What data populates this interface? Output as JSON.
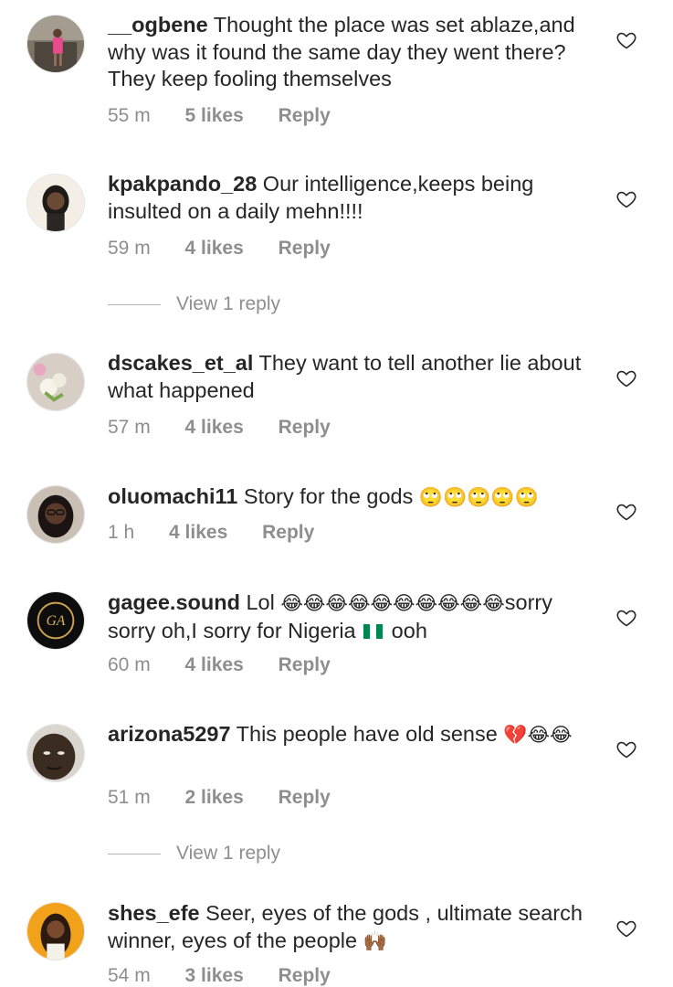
{
  "comments": [
    {
      "user": "__ogbene",
      "text": " Thought the place was set ablaze,and why was it found the same day they went there? They keep fooling themselves",
      "time": "55 m",
      "likes": "5 likes",
      "reply": "Reply",
      "avatar_color": "#7a6a5a"
    },
    {
      "user": "kpakpando_28",
      "text": " Our intelligence,keeps being insulted on a daily mehn!!!!",
      "time": "59 m",
      "likes": "4 likes",
      "reply": "Reply",
      "avatar_color": "#e8dcc8",
      "view_replies": "View 1 reply"
    },
    {
      "user": "dscakes_et_al",
      "text": " They want to tell another lie about what happened",
      "time": "57 m",
      "likes": "4 likes",
      "reply": "Reply",
      "avatar_color": "#d8cfc7"
    },
    {
      "user": "oluomachi11",
      "text": " Story for the gods ",
      "emoji": "🙄🙄🙄🙄🙄",
      "time": "1 h",
      "likes": "4 likes",
      "reply": "Reply",
      "avatar_color": "#3a2a22"
    },
    {
      "user": "gagee.sound",
      "text": " Lol ",
      "emoji": "😂😂😂😂😂😂😂😂😂😂",
      "text2": "sorry sorry oh,I sorry for Nigeria ",
      "flag": "🇳🇬",
      "text3": " ooh",
      "time": "60 m",
      "likes": "4 likes",
      "reply": "Reply",
      "avatar_color": "#111111",
      "avatar_logo": "GA"
    },
    {
      "user": "arizona5297",
      "text": " This people have old sense ",
      "emoji": "💔😂😂",
      "time": "51 m",
      "likes": "2 likes",
      "reply": "Reply",
      "avatar_color": "#4a3b30",
      "view_replies": "View 1 reply"
    },
    {
      "user": "shes_efe",
      "text": " Seer, eyes of the gods , ultimate search winner, eyes of the people ",
      "emoji": "🙌🏾",
      "time": "54 m",
      "likes": "3 likes",
      "reply": "Reply",
      "avatar_color": "#f2a21a"
    }
  ],
  "icons": {
    "like": "heart-icon",
    "avatar": "avatar"
  },
  "colors": {
    "text": "#262626",
    "meta": "#8e8e8e",
    "flag_green": "#008751"
  }
}
